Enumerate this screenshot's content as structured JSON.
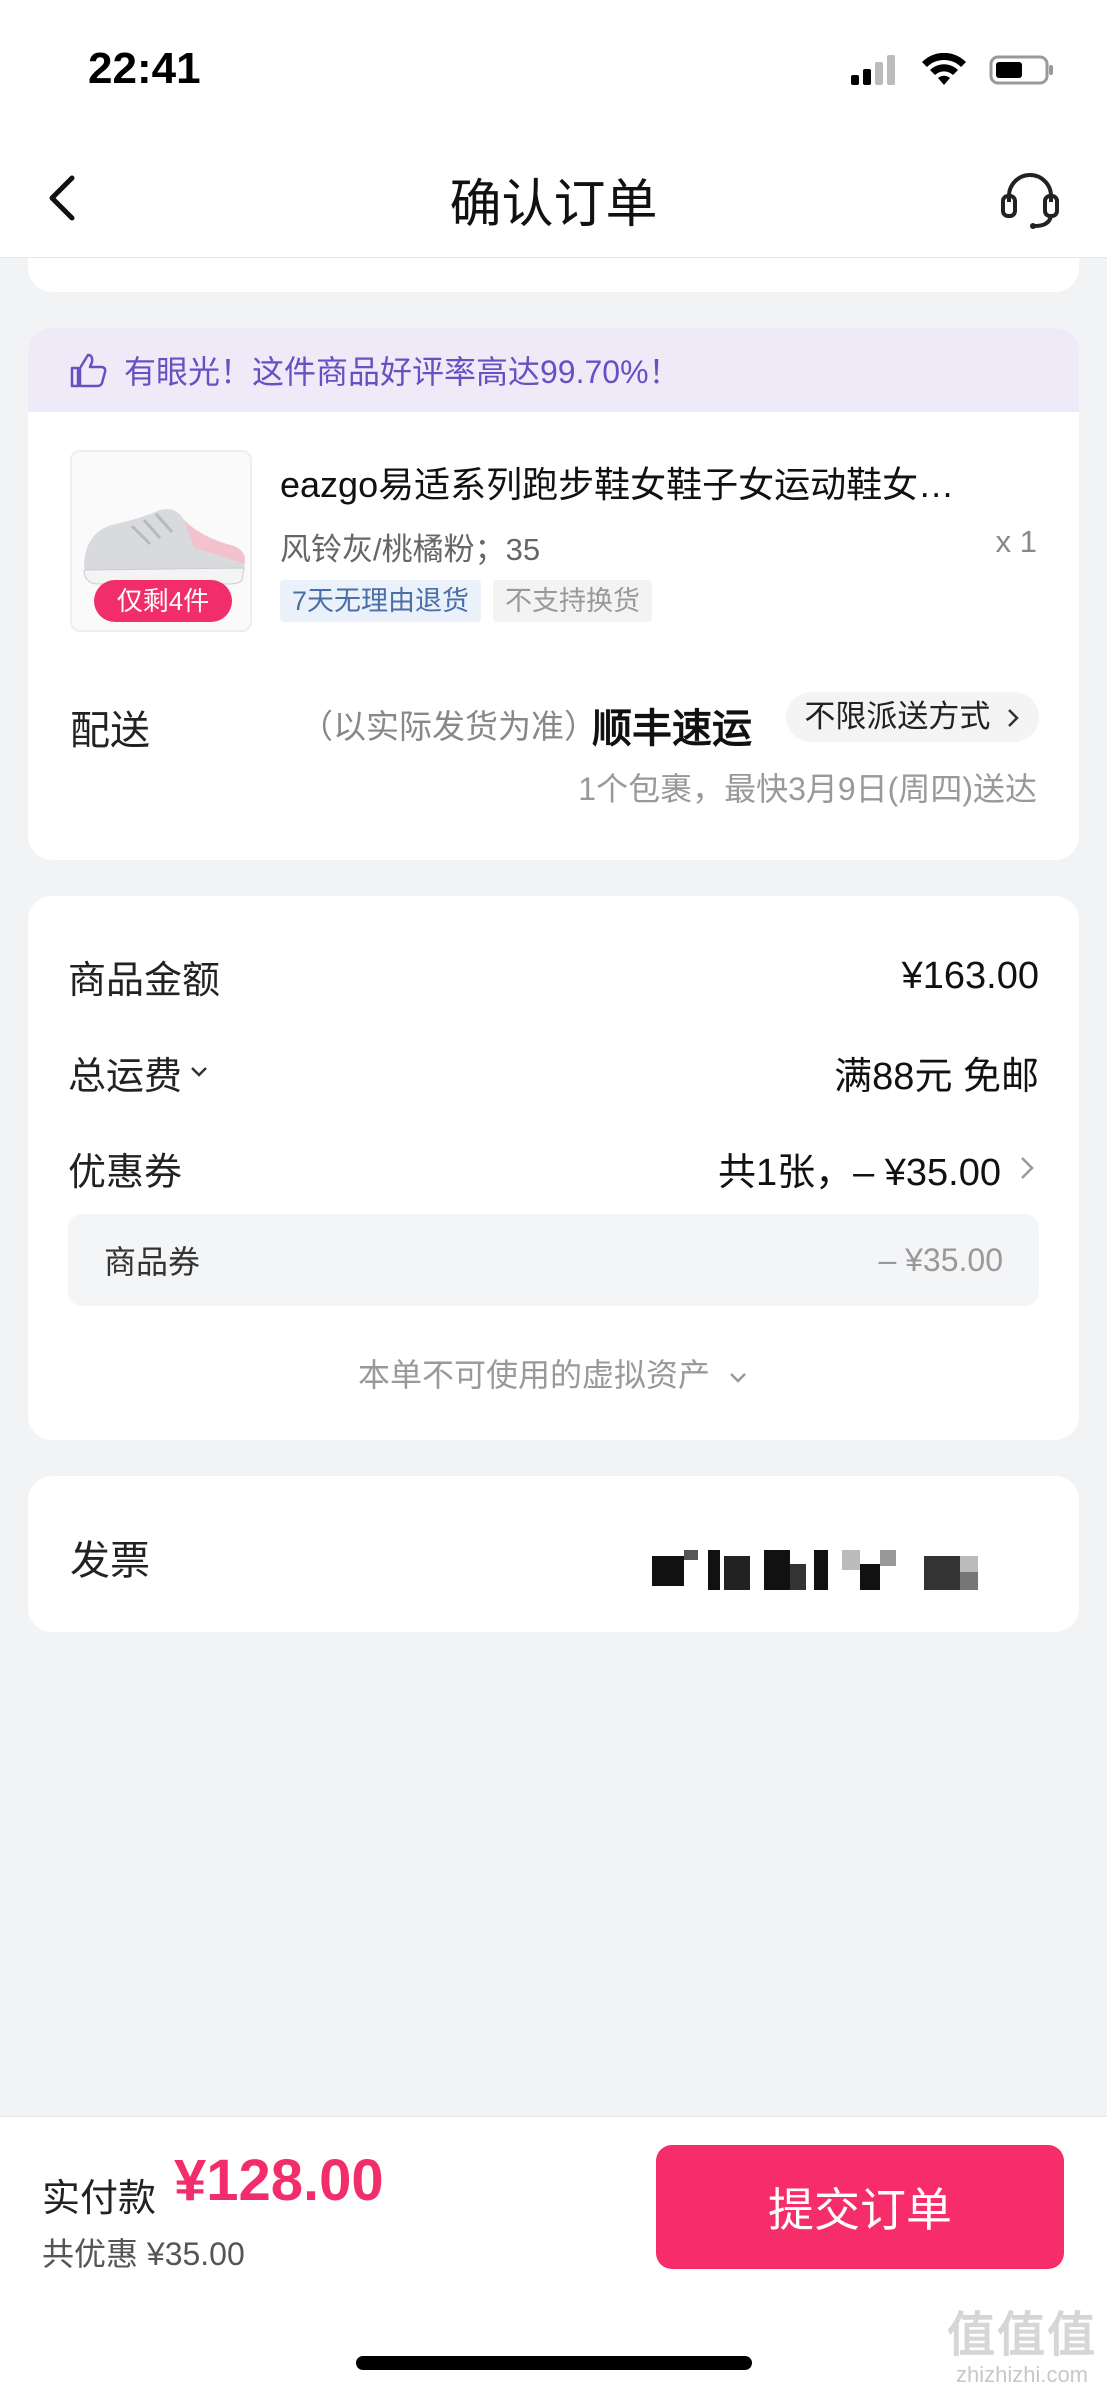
{
  "status_bar": {
    "time": "22:41"
  },
  "nav": {
    "title": "确认订单"
  },
  "praise": {
    "text": "有眼光！这件商品好评率高达99.70%！"
  },
  "product": {
    "title": "eazgo易适系列跑步鞋女鞋子女运动鞋女…",
    "spec": "风铃灰/桃橘粉；35",
    "quantity": "x 1",
    "stock_badge": "仅剩4件",
    "tags": [
      "7天无理由退货",
      "不支持换货"
    ]
  },
  "delivery": {
    "label": "配送",
    "note": "（以实际发货为准）",
    "carrier": "顺丰速运",
    "method": "不限派送方式",
    "eta": "1个包裹，最快3月9日(周四)送达"
  },
  "pricing": {
    "goods_label": "商品金额",
    "goods_value": "¥163.00",
    "shipping_label": "总运费",
    "shipping_value": "满88元 免邮",
    "coupon_label": "优惠券",
    "coupon_value": "共1张，– ¥35.00",
    "coupon_item_label": "商品券",
    "coupon_item_value": "– ¥35.00",
    "virtual_assets": "本单不可使用的虚拟资产"
  },
  "invoice": {
    "label": "发票"
  },
  "footer": {
    "pay_label": "实付款",
    "pay_amount": "¥128.00",
    "discount": "共优惠 ¥35.00",
    "submit": "提交订单"
  },
  "watermark": {
    "main": "值值值",
    "sub": "zhizhizhi.com"
  },
  "colors": {
    "accent": "#f72d6a",
    "praise_bg": "#efeaf8",
    "praise_text": "#6a4fc2"
  }
}
